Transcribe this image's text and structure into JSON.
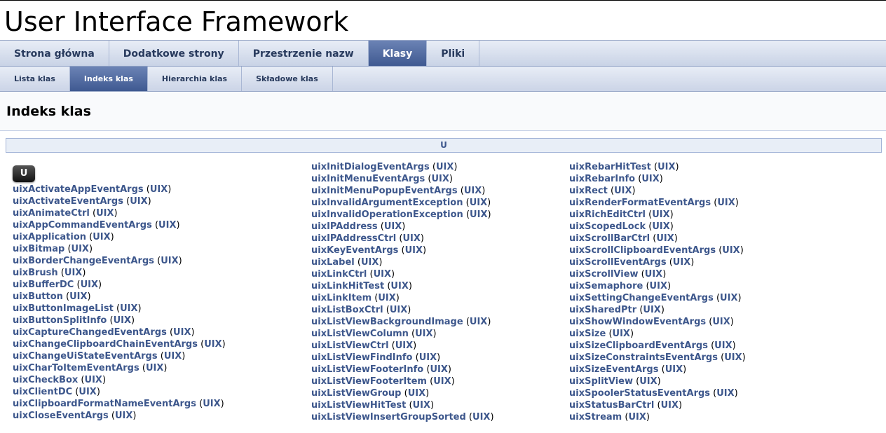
{
  "project_title": "User Interface Framework",
  "tabs": [
    {
      "label": "Strona główna"
    },
    {
      "label": "Dodatkowe strony"
    },
    {
      "label": "Przestrzenie nazw"
    },
    {
      "label": "Klasy"
    },
    {
      "label": "Pliki"
    }
  ],
  "subtabs": [
    {
      "label": "Lista klas"
    },
    {
      "label": "Indeks klas"
    },
    {
      "label": "Hierarchia klas"
    },
    {
      "label": "Składowe klas"
    }
  ],
  "page_title": "Indeks klas",
  "letter_bar": "U",
  "letter_badge": "U",
  "namespace": "UIX",
  "columns": [
    [
      "uixActivateAppEventArgs",
      "uixActivateEventArgs",
      "uixAnimateCtrl",
      "uixAppCommandEventArgs",
      "uixApplication",
      "uixBitmap",
      "uixBorderChangeEventArgs",
      "uixBrush",
      "uixBufferDC",
      "uixButton",
      "uixButtonImageList",
      "uixButtonSplitInfo",
      "uixCaptureChangedEventArgs",
      "uixChangeClipboardChainEventArgs",
      "uixChangeUiStateEventArgs",
      "uixCharToItemEventArgs",
      "uixCheckBox",
      "uixClientDC",
      "uixClipboardFormatNameEventArgs",
      "uixCloseEventArgs"
    ],
    [
      "uixInitDialogEventArgs",
      "uixInitMenuEventArgs",
      "uixInitMenuPopupEventArgs",
      "uixInvalidArgumentException",
      "uixInvalidOperationException",
      "uixIPAddress",
      "uixIPAddressCtrl",
      "uixKeyEventArgs",
      "uixLabel",
      "uixLinkCtrl",
      "uixLinkHitTest",
      "uixLinkItem",
      "uixListBoxCtrl",
      "uixListViewBackgroundImage",
      "uixListViewColumn",
      "uixListViewCtrl",
      "uixListViewFindInfo",
      "uixListViewFooterInfo",
      "uixListViewFooterItem",
      "uixListViewGroup",
      "uixListViewHitTest",
      "uixListViewInsertGroupSorted"
    ],
    [
      "uixRebarHitTest",
      "uixRebarInfo",
      "uixRect",
      "uixRenderFormatEventArgs",
      "uixRichEditCtrl",
      "uixScopedLock",
      "uixScrollBarCtrl",
      "uixScrollClipboardEventArgs",
      "uixScrollEventArgs",
      "uixScrollView",
      "uixSemaphore",
      "uixSettingChangeEventArgs",
      "uixSharedPtr",
      "uixShowWindowEventArgs",
      "uixSize",
      "uixSizeClipboardEventArgs",
      "uixSizeConstraintsEventArgs",
      "uixSizeEventArgs",
      "uixSplitView",
      "uixSpoolerStatusEventArgs",
      "uixStatusBarCtrl",
      "uixStream"
    ]
  ]
}
